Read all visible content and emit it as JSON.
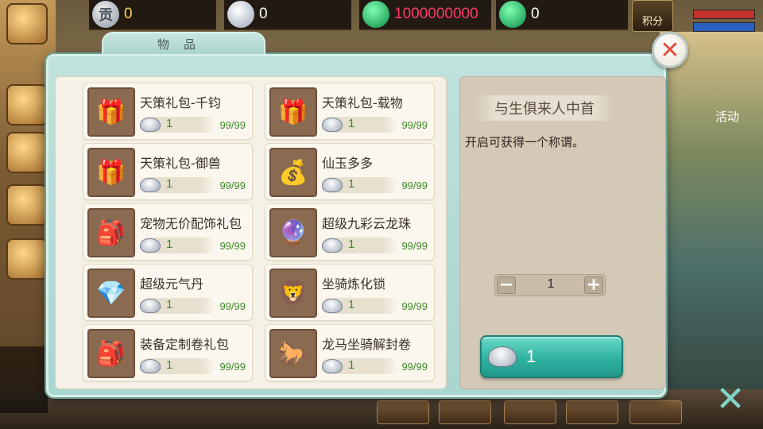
{
  "resources": {
    "coupon_icon": "贡",
    "coupon": "0",
    "silver": "0",
    "jade": "1000000000",
    "bound_jade": "0"
  },
  "score_label": "积分",
  "panel_tab": "物品",
  "side_activity": "活动",
  "items": [
    {
      "name": "天策礼包-千钧",
      "price": "1",
      "stock": "99/99",
      "icon": "🎁"
    },
    {
      "name": "天策礼包-载物",
      "price": "1",
      "stock": "99/99",
      "icon": "🎁"
    },
    {
      "name": "天策礼包-御兽",
      "price": "1",
      "stock": "99/99",
      "icon": "🎁"
    },
    {
      "name": "仙玉多多",
      "price": "1",
      "stock": "99/99",
      "icon": "💰"
    },
    {
      "name": "宠物无价配饰礼包",
      "price": "1",
      "stock": "99/99",
      "icon": "🎒"
    },
    {
      "name": "超级九彩云龙珠",
      "price": "1",
      "stock": "99/99",
      "icon": "🔮"
    },
    {
      "name": "超级元气丹",
      "price": "1",
      "stock": "99/99",
      "icon": "💎"
    },
    {
      "name": "坐骑炼化锁",
      "price": "1",
      "stock": "99/99",
      "icon": "🦁"
    },
    {
      "name": "装备定制卷礼包",
      "price": "1",
      "stock": "99/99",
      "icon": "🎒"
    },
    {
      "name": "龙马坐骑解封卷",
      "price": "1",
      "stock": "99/99",
      "icon": "🐎"
    }
  ],
  "detail": {
    "title": "与生俱来人中首",
    "description": "开启可获得一个称谓。",
    "quantity": "1",
    "total_price": "1"
  },
  "colors": {
    "panel": "#a9d6cf",
    "price_green": "#3e8a2a",
    "buy_button": "#2fb3a1",
    "close_x": "#e0503c"
  }
}
